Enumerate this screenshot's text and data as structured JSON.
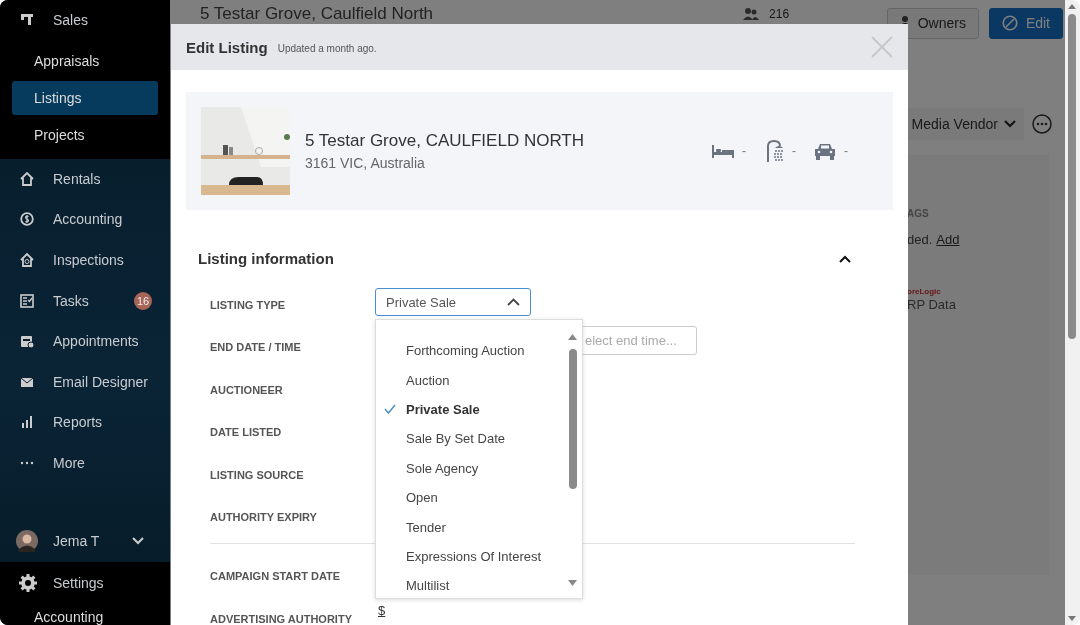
{
  "sidebar": {
    "items": [
      {
        "label": "Sales",
        "selected": false,
        "children": [
          {
            "label": "Appraisals",
            "selected": false
          },
          {
            "label": "Listings",
            "selected": true
          },
          {
            "label": "Projects",
            "selected": false
          }
        ]
      },
      {
        "label": "Rentals",
        "selected": false
      },
      {
        "label": "Accounting",
        "selected": false
      },
      {
        "label": "Inspections",
        "selected": false
      },
      {
        "label": "Tasks",
        "selected": false,
        "badge": "16"
      },
      {
        "label": "Appointments",
        "selected": false
      },
      {
        "label": "Email Designer",
        "selected": false
      },
      {
        "label": "Reports",
        "selected": false
      },
      {
        "label": "More",
        "selected": false
      }
    ],
    "user": {
      "name": "Jema T"
    },
    "settings": {
      "label": "Settings",
      "children": [
        {
          "label": "Accounting"
        }
      ]
    }
  },
  "background_page": {
    "title": "5 Testar Grove, Caulfield North",
    "people_count": "216",
    "owners_button": "Owners",
    "edit_button": "Edit",
    "contact_role": "Media Vendor",
    "tags_heading": "AGS",
    "tags_text": "ded.",
    "tags_link": "Add",
    "data_logo": "oreLogic",
    "data_source": "RP Data"
  },
  "modal": {
    "title": "Edit Listing",
    "updated": "Updated a month ago.",
    "property": {
      "address": "5 Testar Grove, CAULFIELD NORTH",
      "locality": "3161 VIC, Australia",
      "features": [
        {
          "kind": "bed",
          "value": "-"
        },
        {
          "kind": "bath",
          "value": "-"
        },
        {
          "kind": "car",
          "value": "-"
        }
      ]
    },
    "section": {
      "title": "Listing information",
      "expanded": true,
      "fields": [
        {
          "label": "LISTING TYPE",
          "kind": "select",
          "value": "Private Sale",
          "open": true
        },
        {
          "label": "END DATE / TIME",
          "kind": "datetime",
          "placeholder": "elect end time..."
        },
        {
          "label": "AUCTIONEER"
        },
        {
          "label": "DATE LISTED"
        },
        {
          "label": "LISTING SOURCE"
        },
        {
          "label": "AUTHORITY EXPIRY"
        }
      ],
      "campaign_fields": [
        {
          "label": "CAMPAIGN START DATE"
        },
        {
          "label": "ADVERTISING AUTHORITY",
          "kind": "link",
          "value": "$"
        }
      ]
    },
    "dropdown": {
      "options": [
        {
          "label": "Forthcoming Auction",
          "selected": false
        },
        {
          "label": "Auction",
          "selected": false
        },
        {
          "label": "Private Sale",
          "selected": true
        },
        {
          "label": "Sale By Set Date",
          "selected": false
        },
        {
          "label": "Sole Agency",
          "selected": false
        },
        {
          "label": "Open",
          "selected": false
        },
        {
          "label": "Tender",
          "selected": false
        },
        {
          "label": "Expressions Of Interest",
          "selected": false
        },
        {
          "label": "Multilist",
          "selected": false
        }
      ]
    }
  }
}
